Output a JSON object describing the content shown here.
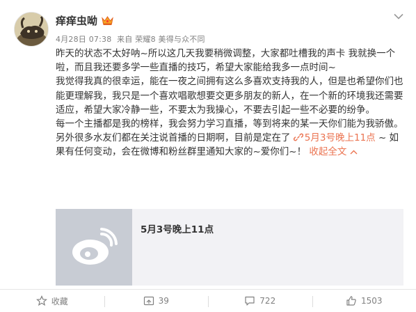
{
  "post": {
    "username": "痒痒虫呦",
    "meta": {
      "date": "4月28日 07:38",
      "source": "来自 荣耀8 美得与众不同"
    },
    "paragraphs": [
      "昨天的状态不太好呐~所以这几天我要稍微调整，大家都吐槽我的声卡 我就换一个啦，而且我还要多学一些直播的技巧，希望大家能给我多一点时间~",
      "我觉得我真的很幸运，能在一夜之间拥有这么多喜欢支持我的人，但是也希望你们也能更理解我，我只是一个喜欢唱歌想要交更多朋友的新人，在一个新的环境我还需要适应，希望大家冷静一些，不要太为我操心，不要去引起一些不必要的纷争。",
      "每一个主播都是我的榜样，我会努力学习直播，等到将来的某一天你们能为我骄傲。"
    ],
    "last_paragraph": {
      "before": "另外很多水友们都在关注说首播的日期啊，目前是定在了",
      "link_text": "5月3号晚上11点",
      "after": " ~ 如果有任何变动，会在微博和粉丝群里通知大家的~爱你们~！",
      "expand_label": "收起全文"
    },
    "link_card": {
      "title": "5月3号晚上11点"
    }
  },
  "footer": {
    "favorite_label": "收藏",
    "repost_count": "39",
    "comment_count": "722",
    "like_count": "1503"
  },
  "colors": {
    "link": "#eb7350",
    "muted": "#808080",
    "card_bg": "#f2f2f5"
  }
}
